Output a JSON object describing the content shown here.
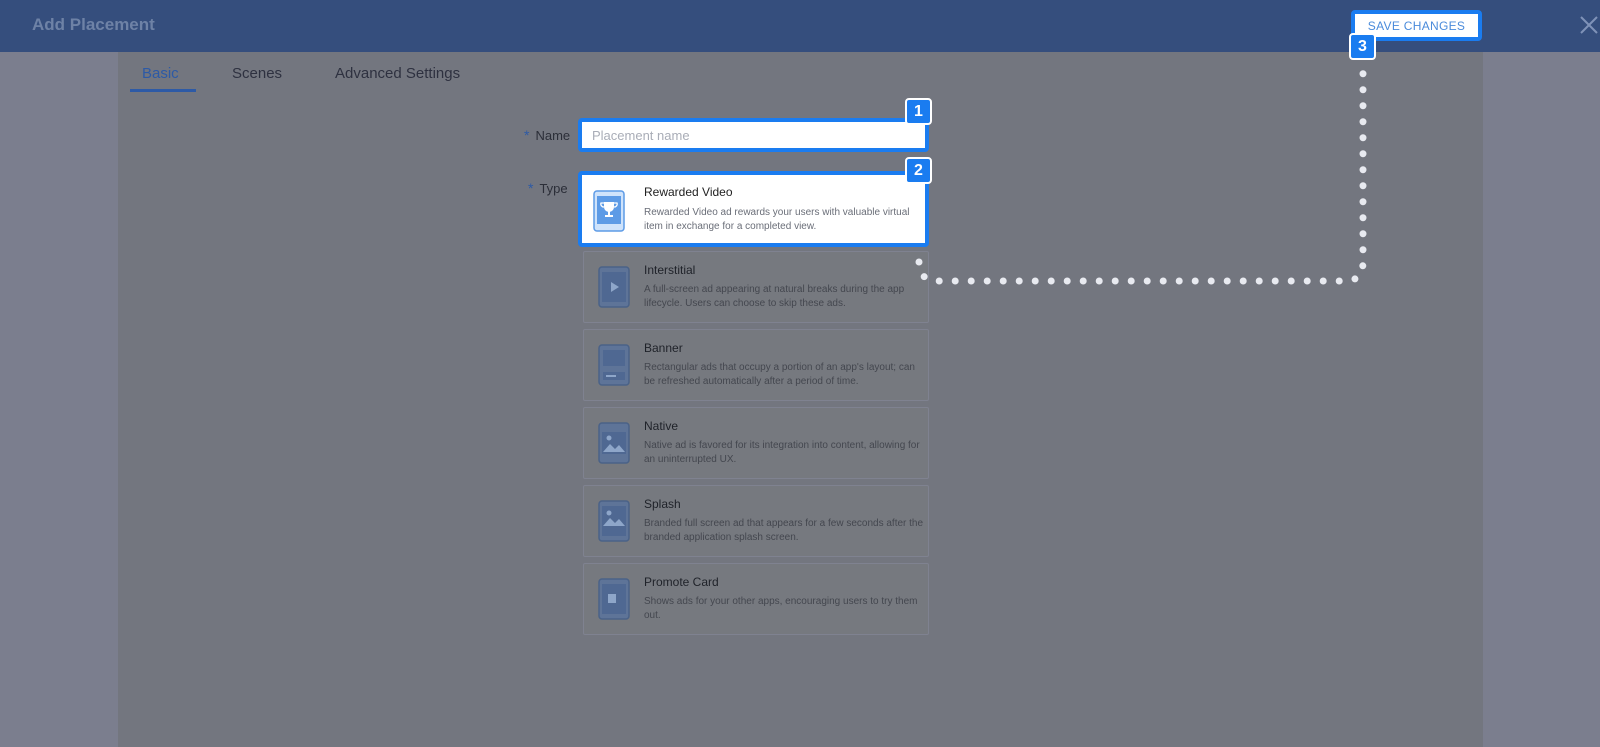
{
  "header": {
    "title": "Add Placement",
    "save_label": "SAVE CHANGES",
    "close_icon": "close-icon"
  },
  "tabs": [
    {
      "label": "Basic",
      "active": true
    },
    {
      "label": "Scenes",
      "active": false
    },
    {
      "label": "Advanced Settings",
      "active": false
    }
  ],
  "form": {
    "name_label": "Name",
    "name_placeholder": "Placement name",
    "name_value": "",
    "type_label": "Type",
    "required_mark": "*"
  },
  "types": [
    {
      "title": "Rewarded Video",
      "desc": "Rewarded Video ad rewards your users with valuable virtual item in exchange for a completed view.",
      "icon": "trophy-icon",
      "selected": true
    },
    {
      "title": "Interstitial",
      "desc": "A full-screen ad appearing at natural breaks during the app lifecycle. Users can choose to skip these ads.",
      "icon": "play-icon",
      "selected": false
    },
    {
      "title": "Banner",
      "desc": "Rectangular ads that occupy a portion of an app's layout; can be refreshed automatically after a period of time.",
      "icon": "banner-icon",
      "selected": false
    },
    {
      "title": "Native",
      "desc": "Native ad is favored for its integration into content, allowing for an uninterrupted UX.",
      "icon": "image-icon",
      "selected": false
    },
    {
      "title": "Splash",
      "desc": "Branded full screen ad that appears for a few seconds after the branded application splash screen.",
      "icon": "splash-icon",
      "selected": false
    },
    {
      "title": "Promote Card",
      "desc": "Shows ads for your other apps, encouraging users to try them out.",
      "icon": "card-icon",
      "selected": false
    }
  ],
  "steps": [
    "1",
    "2",
    "3"
  ],
  "colors": {
    "highlight": "#1a7cf0",
    "header_bg": "#354e7d",
    "accent": "#2d5aa6"
  }
}
